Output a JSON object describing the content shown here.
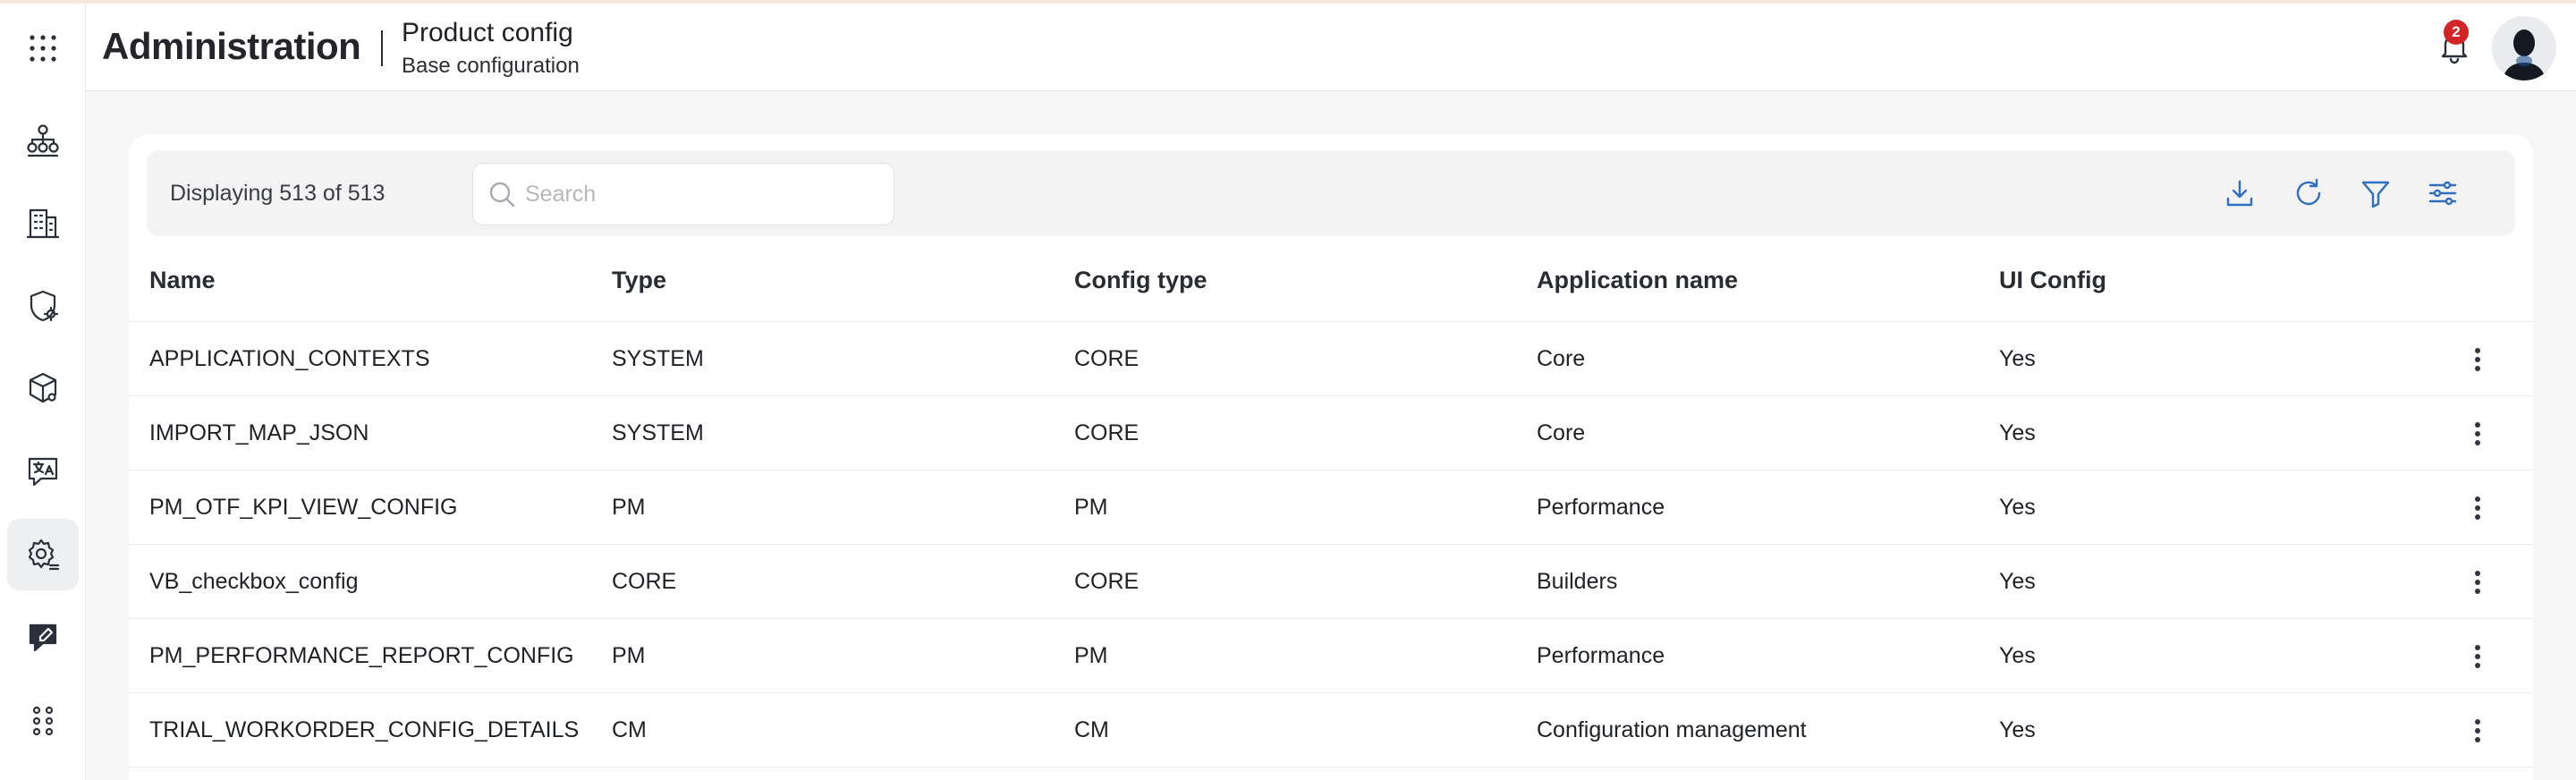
{
  "header": {
    "app_title": "Administration",
    "page_title": "Product config",
    "page_subtitle": "Base configuration",
    "notification_count": "2"
  },
  "sidebar": {
    "items": [
      {
        "icon": "apps-grid-icon"
      },
      {
        "icon": "hierarchy-icon"
      },
      {
        "icon": "building-icon"
      },
      {
        "icon": "shield-settings-icon"
      },
      {
        "icon": "cube-settings-icon"
      },
      {
        "icon": "translate-icon"
      },
      {
        "icon": "settings-icon",
        "active": true
      },
      {
        "icon": "chat-edit-icon"
      },
      {
        "icon": "apps-small-icon"
      }
    ]
  },
  "toolbar": {
    "count_text": "Displaying 513 of 513",
    "search_placeholder": "Search",
    "search_value": ""
  },
  "table": {
    "columns": [
      "Name",
      "Type",
      "Config type",
      "Application name",
      "UI Config"
    ],
    "rows": [
      [
        "APPLICATION_CONTEXTS",
        "SYSTEM",
        "CORE",
        "Core",
        "Yes"
      ],
      [
        "IMPORT_MAP_JSON",
        "SYSTEM",
        "CORE",
        "Core",
        "Yes"
      ],
      [
        "PM_OTF_KPI_VIEW_CONFIG",
        "PM",
        "PM",
        "Performance",
        "Yes"
      ],
      [
        "VB_checkbox_config",
        "CORE",
        "CORE",
        "Builders",
        "Yes"
      ],
      [
        "PM_PERFORMANCE_REPORT_CONFIG",
        "PM",
        "PM",
        "Performance",
        "Yes"
      ],
      [
        "TRIAL_WORKORDER_CONFIG_DETAILS",
        "CM",
        "CM",
        "Configuration management",
        "Yes"
      ]
    ]
  },
  "colors": {
    "accent_blue": "#2f6fc0",
    "badge_red": "#d32525",
    "active_nav_bg": "#eeeff1"
  }
}
